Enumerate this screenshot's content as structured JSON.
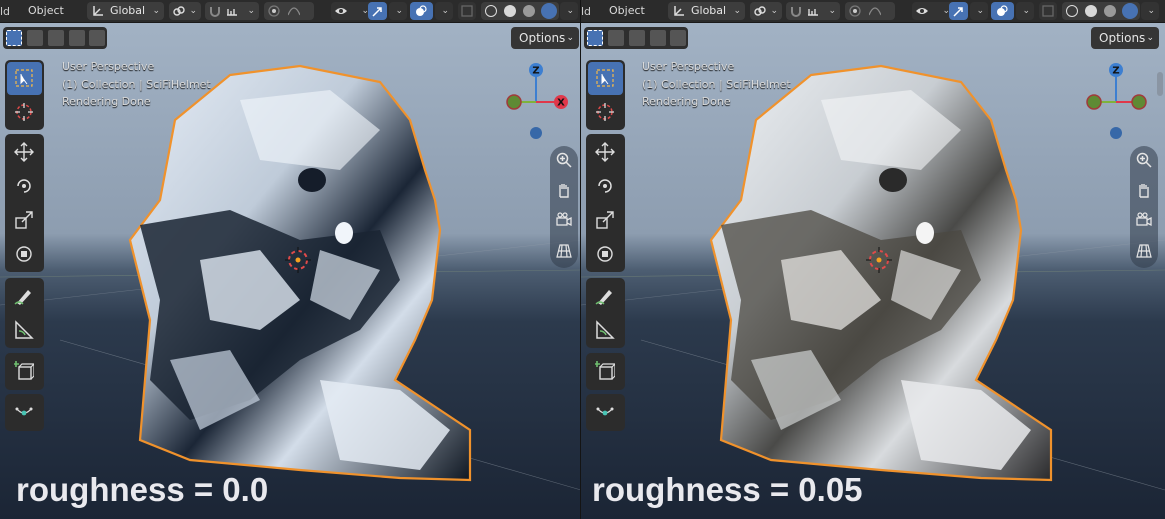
{
  "header": {
    "edge_text": "ld",
    "mode_label": "Object",
    "transform_orientation": "Global",
    "chevron": "⌄"
  },
  "tool_settings": {
    "options_label": "Options"
  },
  "overlay": {
    "view_name": "User Perspective",
    "collection_info": "(1) Collection | SciFiHelmet",
    "status": "Rendering Done"
  },
  "gizmo": {
    "z_label": "Z",
    "x_label": "X"
  },
  "viewports": [
    {
      "caption": "roughness = 0.0"
    },
    {
      "caption": "roughness = 0.05"
    }
  ],
  "colors": {
    "accent_blue": "#4772b3",
    "selection_outline": "#f0922c",
    "axis_x": "#e0384a",
    "axis_y": "#7fb23a",
    "axis_z": "#3d7fd1"
  },
  "icons": [
    "cursor-select-icon",
    "cursor-3d-icon",
    "move-icon",
    "rotate-icon",
    "scale-icon",
    "transform-icon",
    "annotate-icon",
    "measure-icon",
    "add-cube-icon",
    "shear-icon",
    "zoom-icon",
    "hand-pan-icon",
    "camera-icon",
    "grid-ortho-icon"
  ]
}
